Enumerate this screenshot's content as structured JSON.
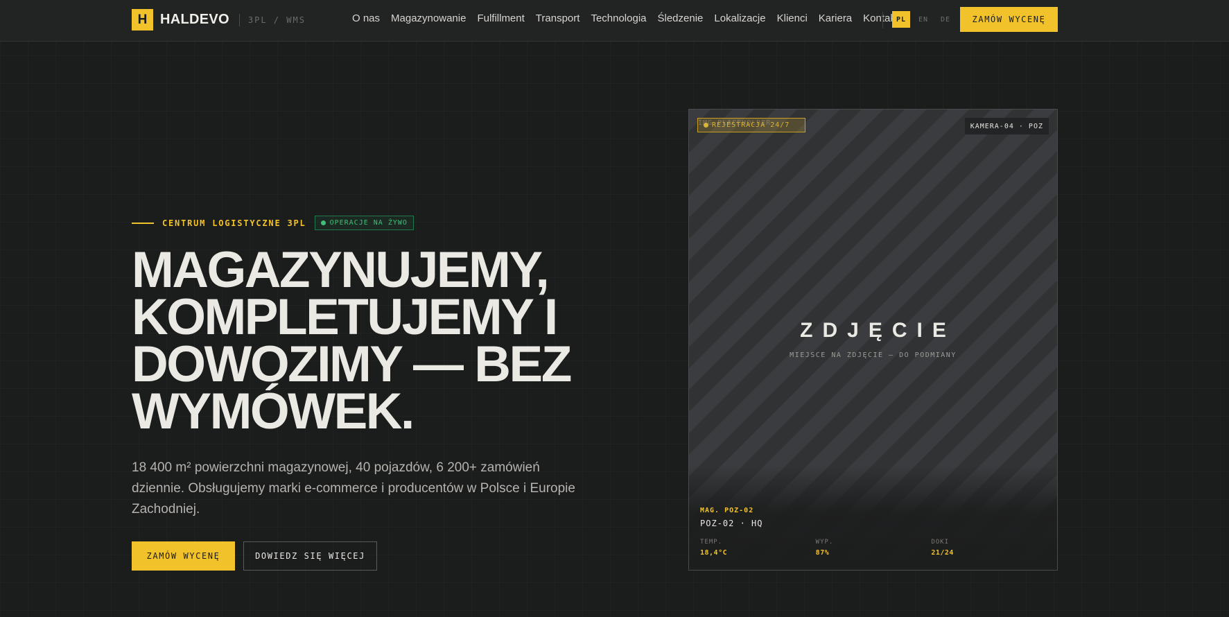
{
  "brand": {
    "mark": "H",
    "name": "HALDEVO",
    "sub": "3PL / WMS"
  },
  "nav": {
    "items": [
      "O nas",
      "Magazynowanie",
      "Fulfillment",
      "Transport",
      "Technologia",
      "Śledzenie",
      "Lokalizacje",
      "Klienci",
      "Kariera",
      "Kontakt"
    ]
  },
  "lang": {
    "options": [
      "PL",
      "EN",
      "DE"
    ],
    "active": "PL"
  },
  "header_cta": "ZAMÓW WYCENĘ",
  "hero": {
    "eyebrow": "CENTRUM LOGISTYCZNE 3PL",
    "live_badge": "OPERACJE NA ŻYWO",
    "headline_lines": [
      "MAGAZYNUJEMY,",
      "KOMPLETUJEMY I",
      "DOWOZIMY — BEZ",
      "WYMÓWEK."
    ],
    "lede": "18 400 m² powierzchni magazynowej, 40 pojazdów, 6 200+ zamówień dziennie. Obsługujemy marki e-commerce i producentów w Polsce i Europie Zachodniej.",
    "primary_button": "ZAMÓW WYCENĘ",
    "secondary_button": "DOWIEDZ SIĘ WIĘCEJ"
  },
  "photo": {
    "rec_badge": "REJESTRACJA 24/7",
    "placeholder_tag": "IMG PLACEHOLDER",
    "camera": "KAMERA-04 · POZ",
    "title": "ZDJĘCIE",
    "subtitle": "MIEJSCE NA ZDJĘCIE — DO PODMIANY",
    "mag_label": "MAG. POZ-02",
    "mag_name": "POZ-02 · HQ",
    "stats": [
      {
        "label": "TEMP.",
        "value": "18,4°C"
      },
      {
        "label": "WYP.",
        "value": "87%"
      },
      {
        "label": "DOKI",
        "value": "21/24"
      }
    ]
  },
  "colors": {
    "accent": "#f2c22b",
    "background": "#1b1c1c",
    "live": "#3fbf78"
  }
}
